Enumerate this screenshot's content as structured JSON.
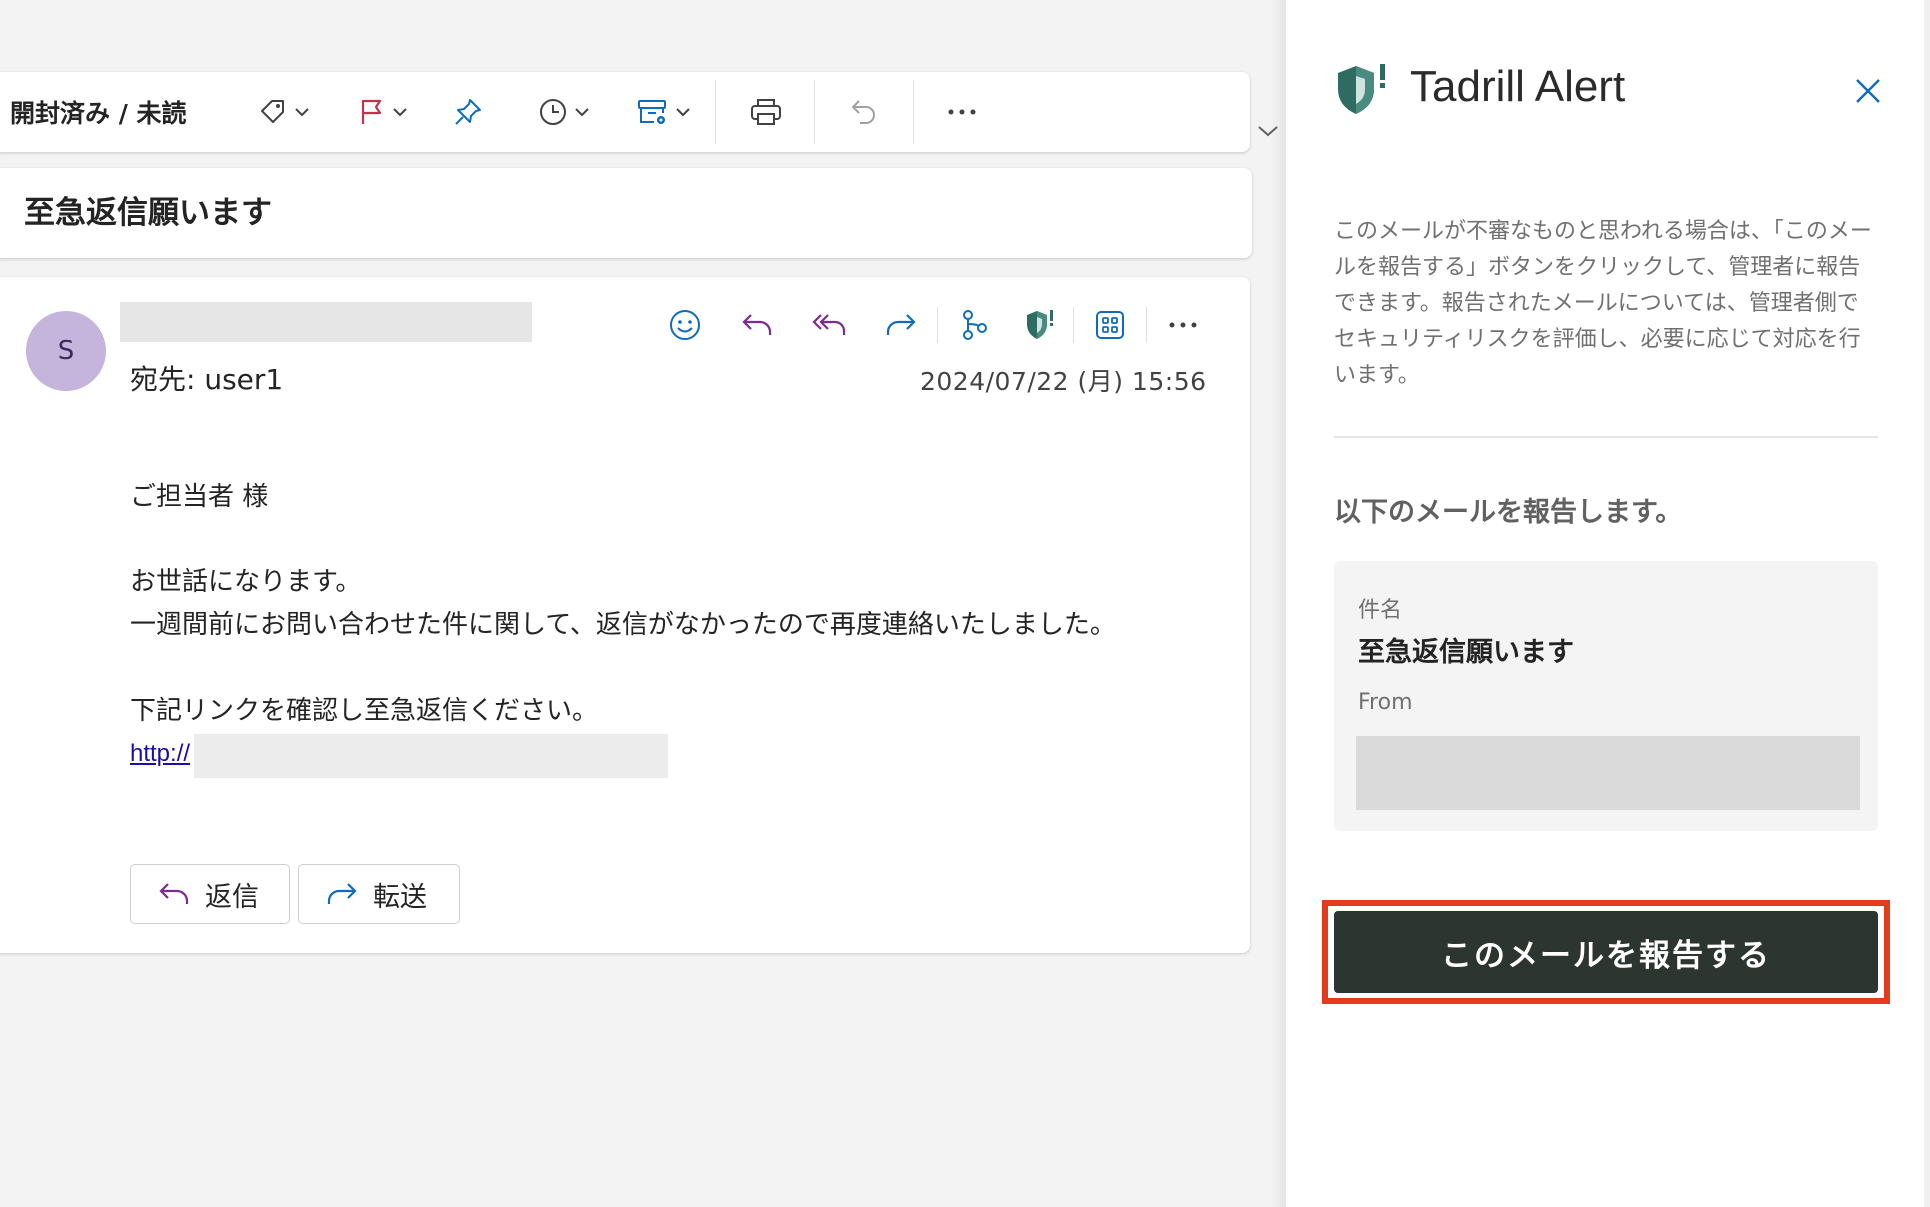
{
  "toolbar": {
    "read_unread_label": "開封済み / 未読"
  },
  "email": {
    "subject": "至急返信願います",
    "avatar_initial": "S",
    "to_line": "宛先:  user1",
    "date": "2024/07/22 (月) 15:56",
    "body": {
      "greeting": "ご担当者 様",
      "line1": "お世話になります。",
      "line2": "一週間前にお問い合わせた件に関して、返信がなかったので再度連絡いたしました。",
      "line3": "下記リンクを確認し至急返信ください。",
      "link_text": "http://"
    },
    "actions": {
      "reply": "返信",
      "forward": "転送"
    }
  },
  "panel": {
    "title": "Tadrill Alert",
    "description": "このメールが不審なものと思われる場合は、「このメールを報告する」ボタンをクリックして、管理者に報告できます。報告されたメールについては、管理者側でセキュリティリスクを評価し、必要に応じて対応を行います。",
    "subheading": "以下のメールを報告します。",
    "subject_label": "件名",
    "subject_value": "至急返信願います",
    "from_label": "From",
    "report_button": "このメールを報告する"
  },
  "colors": {
    "accent": "#0f6cbd",
    "purple_icon": "#7b2b8e",
    "flag_red": "#c4314b",
    "shield_teal": "#2e6b61",
    "report_button_bg": "#2c352f",
    "highlight_red": "#e43b1d",
    "avatar_bg": "#c5b4dc"
  },
  "icons": [
    "tag-icon",
    "flag-icon",
    "pin-icon",
    "clock-icon",
    "archive-rule-icon",
    "print-icon",
    "undo-icon",
    "more-icon",
    "emoji-icon",
    "reply-icon",
    "reply-all-icon",
    "forward-icon",
    "loop-icon",
    "shield-alert-icon",
    "apps-icon",
    "close-icon"
  ]
}
